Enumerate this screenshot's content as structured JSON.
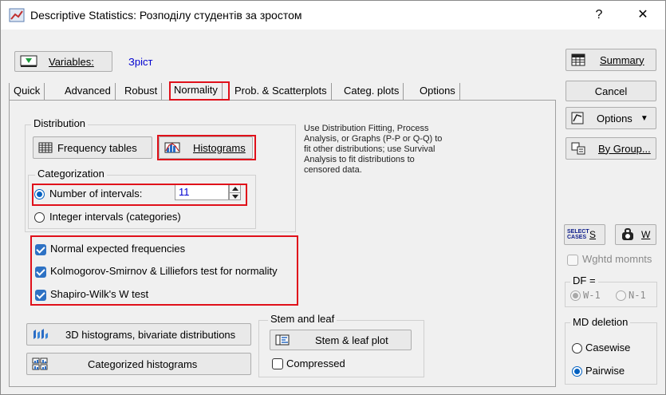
{
  "window": {
    "title": "Descriptive Statistics: Розподілу студентів за зростом",
    "help_label": "?",
    "close_label": "✕"
  },
  "variables": {
    "button_label": "Variables:",
    "value": "Зріст"
  },
  "tabs": [
    {
      "label": "Quick"
    },
    {
      "label": "Advanced"
    },
    {
      "label": "Robust"
    },
    {
      "label": "Normality"
    },
    {
      "label": "Prob. & Scatterplots"
    },
    {
      "label": "Categ. plots"
    },
    {
      "label": "Options"
    }
  ],
  "distribution": {
    "group_label": "Distribution",
    "frequency_tables_label": "Frequency tables",
    "histograms_label": "Histograms"
  },
  "categorization": {
    "group_label": "Categorization",
    "number_of_intervals_label": "Number of intervals:",
    "number_of_intervals_value": "11",
    "integer_intervals_label": "Integer intervals (categories)"
  },
  "description": "Use Distribution Fitting, Process Analysis, or Graphs (P-P or Q-Q) to fit other distributions; use Survival Analysis to fit distributions to censored data.",
  "checks": {
    "normal_expected": "Normal expected frequencies",
    "ks_lilliefors": "Kolmogorov-Smirnov & Lilliefors test for normality",
    "shapiro_wilk": "Shapiro-Wilk's W test"
  },
  "buttons": {
    "hist3d": "3D histograms, bivariate distributions",
    "categorized_histograms": "Categorized histograms"
  },
  "stem_leaf": {
    "group_label": "Stem and leaf",
    "plot_button": "Stem & leaf plot",
    "compressed_label": "Compressed"
  },
  "side": {
    "summary": "Summary",
    "cancel": "Cancel",
    "options": "Options",
    "by_group": "By Group...",
    "select_cases_icon_text": "SELECT CASES",
    "select_cases_label": "S",
    "weight_label": "W",
    "wghtd_momnts": "Wghtd momnts",
    "df_label": "DF =",
    "df_w1": "W-1",
    "df_n1": "N-1",
    "md_deletion_label": "MD deletion",
    "casewise": "Casewise",
    "pairwise": "Pairwise"
  },
  "colors": {
    "highlight": "#e0101a",
    "accent": "#0060c0",
    "variable_value": "#0000d0"
  }
}
